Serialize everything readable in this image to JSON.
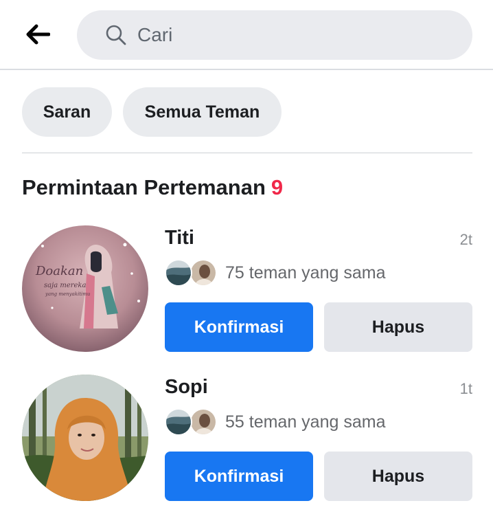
{
  "header": {
    "back_icon": "arrow-left-icon",
    "search_icon": "search-icon",
    "search_placeholder": "Cari"
  },
  "filters": [
    {
      "label": "Saran"
    },
    {
      "label": "Semua Teman"
    }
  ],
  "section": {
    "title": "Permintaan Pertemanan",
    "count": "9"
  },
  "requests": [
    {
      "name": "Titi",
      "time": "2t",
      "mutual_text": "75 teman yang sama",
      "confirm_label": "Konfirmasi",
      "delete_label": "Hapus"
    },
    {
      "name": "Sopi",
      "time": "1t",
      "mutual_text": "55 teman yang sama",
      "confirm_label": "Konfirmasi",
      "delete_label": "Hapus"
    }
  ],
  "colors": {
    "primary": "#1877f2",
    "badge_red": "#f02849",
    "chip_bg": "#e9ebee",
    "secondary_text": "#65676b"
  }
}
